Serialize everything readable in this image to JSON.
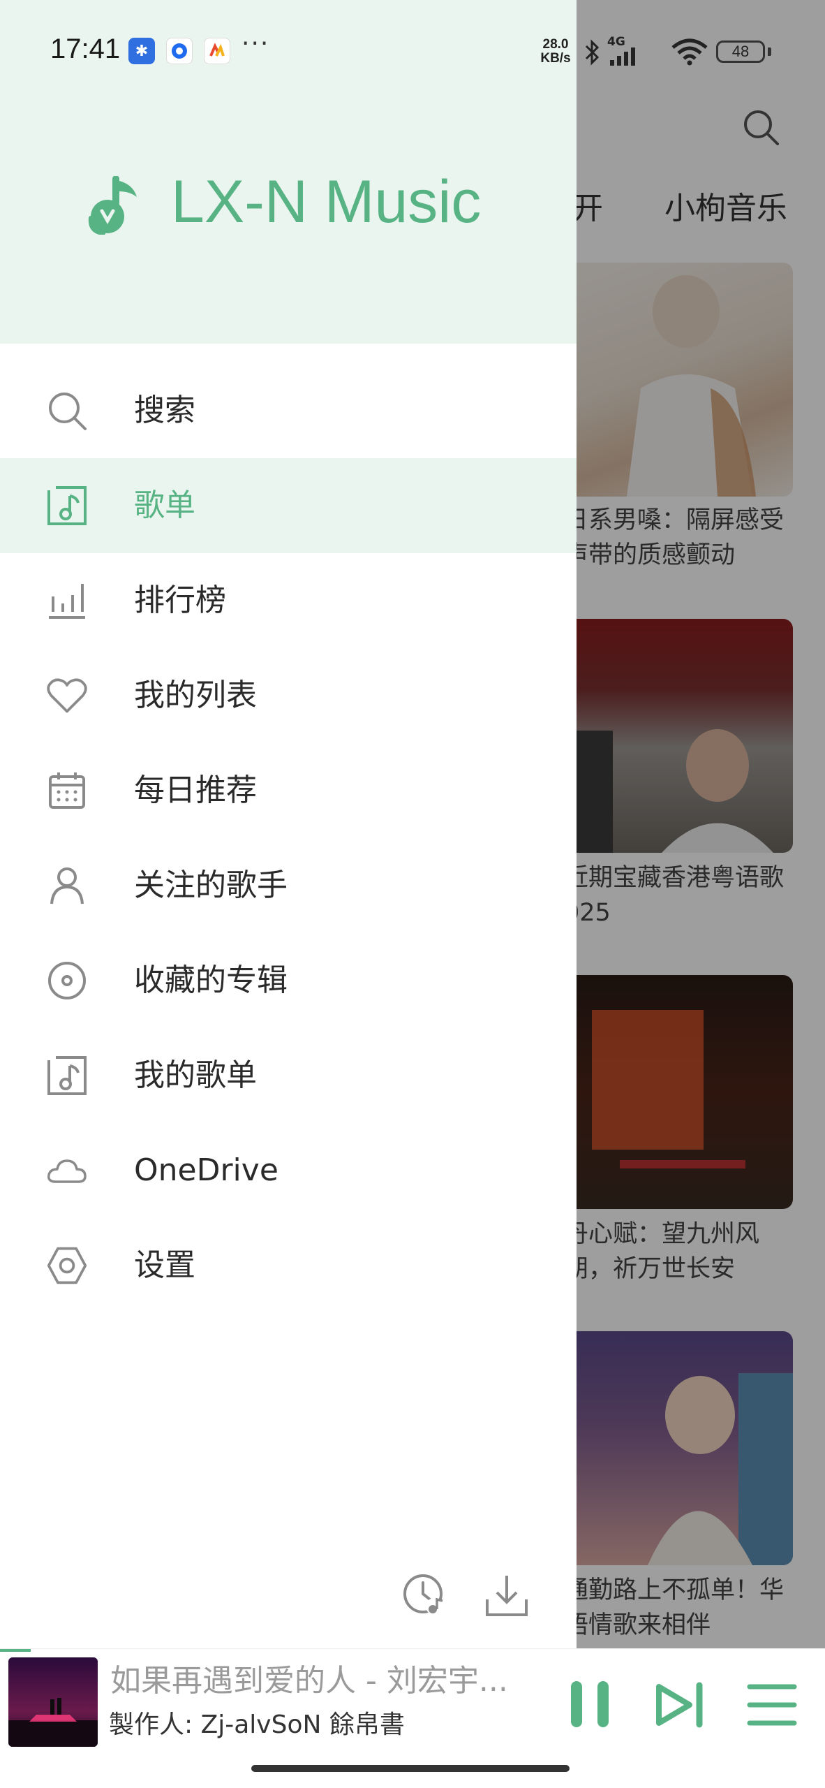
{
  "status_bar": {
    "time": "17:41",
    "net_speed_value": "28.0",
    "net_speed_unit": "KB/s",
    "network": "4G",
    "battery": "48",
    "more": "···"
  },
  "drawer": {
    "app_title": "LX-N Music",
    "menu": [
      {
        "label": "搜索",
        "icon": "search-icon",
        "active": false
      },
      {
        "label": "歌单",
        "icon": "music-file-icon",
        "active": true
      },
      {
        "label": "排行榜",
        "icon": "bar-chart-icon",
        "active": false
      },
      {
        "label": "我的列表",
        "icon": "heart-icon",
        "active": false
      },
      {
        "label": "每日推荐",
        "icon": "calendar-icon",
        "active": false
      },
      {
        "label": "关注的歌手",
        "icon": "person-icon",
        "active": false
      },
      {
        "label": "收藏的专辑",
        "icon": "disc-icon",
        "active": false
      },
      {
        "label": "我的歌单",
        "icon": "music-file-icon",
        "active": false
      },
      {
        "label": "OneDrive",
        "icon": "cloud-icon",
        "active": false
      },
      {
        "label": "设置",
        "icon": "hexagon-settings-icon",
        "active": false
      }
    ]
  },
  "background_page": {
    "tabs": [
      "开",
      "小枸音乐"
    ],
    "cards": [
      {
        "line1": "日系男嗓：隔屏感受",
        "line2": "声带的质感颤动"
      },
      {
        "line1": "近期宝藏香港粤语歌",
        "line2": "025"
      },
      {
        "line1": "丹心赋：望九州风",
        "line2": "胡，祈万世长安"
      },
      {
        "line1": "通勤路上不孤单！华",
        "line2": "语情歌来相伴"
      }
    ]
  },
  "player": {
    "title": "如果再遇到爱的人 - 刘宏宇...",
    "artist": "製作人: Zj-alvSoN 餘帛書"
  },
  "colors": {
    "accent": "#58b384",
    "header_bg": "#e9f5ee",
    "icon_gray": "#8a8a8a"
  }
}
